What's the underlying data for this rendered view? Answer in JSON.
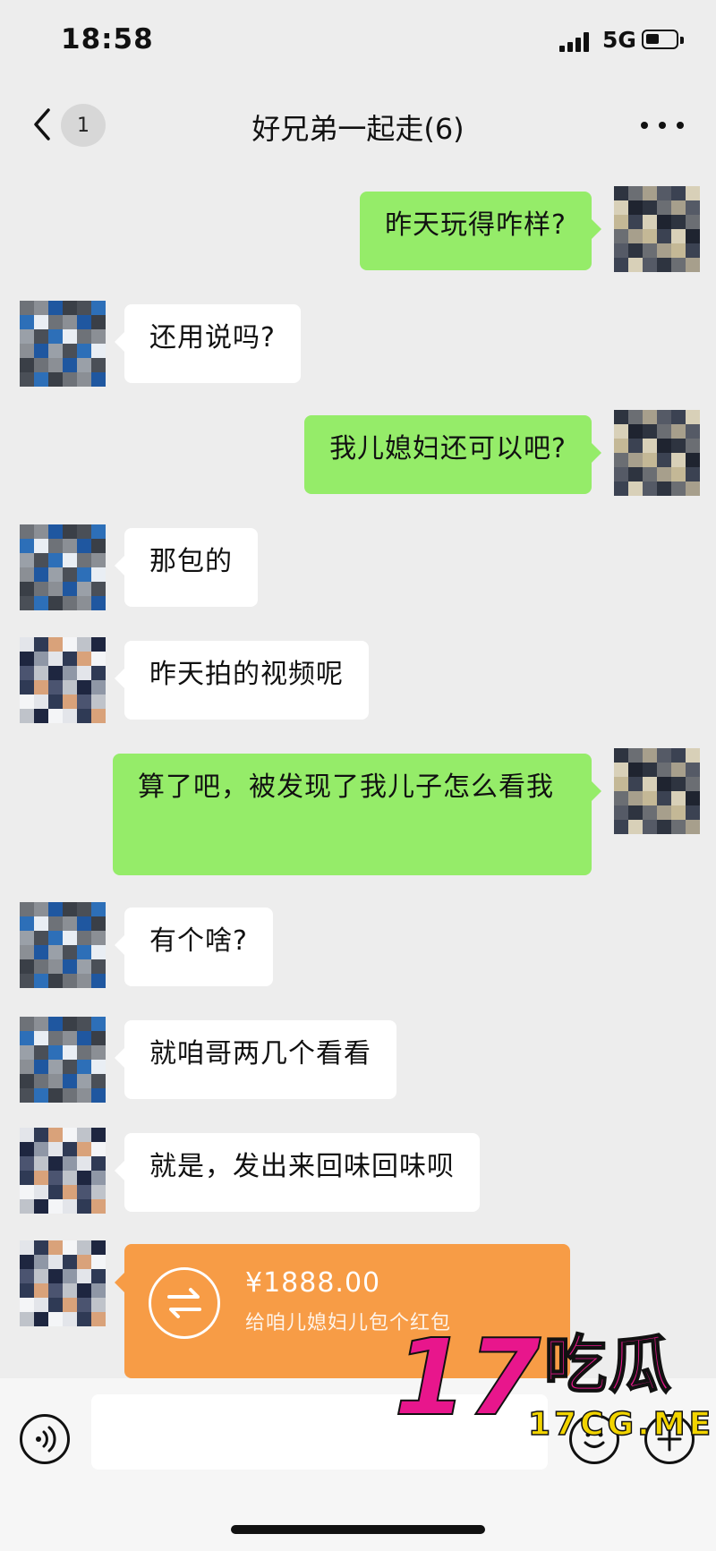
{
  "status_bar": {
    "time": "18:58",
    "network": "5G"
  },
  "header": {
    "unread_count": "1",
    "title": "好兄弟一起走(6)"
  },
  "messages": [
    {
      "side": "out",
      "avatar": "avatar-self",
      "text": "昨天玩得咋样?"
    },
    {
      "side": "in",
      "avatar": "avatar-friend-a",
      "text": "还用说吗?"
    },
    {
      "side": "out",
      "avatar": "avatar-self",
      "text": "我儿媳妇还可以吧?"
    },
    {
      "side": "in",
      "avatar": "avatar-friend-a",
      "text": "那包的"
    },
    {
      "side": "in",
      "avatar": "avatar-friend-b",
      "text": "昨天拍的视频呢"
    },
    {
      "side": "out",
      "avatar": "avatar-self",
      "text": "算了吧，被发现了我儿子怎么看我"
    },
    {
      "side": "in",
      "avatar": "avatar-friend-a",
      "text": "有个啥?"
    },
    {
      "side": "in",
      "avatar": "avatar-friend-a",
      "text": "就咱哥两几个看看"
    },
    {
      "side": "in",
      "avatar": "avatar-friend-b",
      "text": "就是，发出来回味回味呗"
    }
  ],
  "red_packet": {
    "amount": "¥1888.00",
    "note": "给咱儿媳妇儿包个红包"
  },
  "input": {
    "placeholder": ""
  },
  "icons": {
    "back": "chevron-left-icon",
    "more": "more-icon",
    "voice": "voice-icon",
    "emoji": "emoji-icon",
    "plus": "plus-icon",
    "transfer": "transfer-icon"
  },
  "colors": {
    "background": "#ededed",
    "outgoing_bubble": "#95ec69",
    "incoming_bubble": "#ffffff",
    "red_packet": "#f79c46"
  },
  "watermark": {
    "big": "17",
    "cn": "吃瓜",
    "domain": "17CG.ME"
  }
}
